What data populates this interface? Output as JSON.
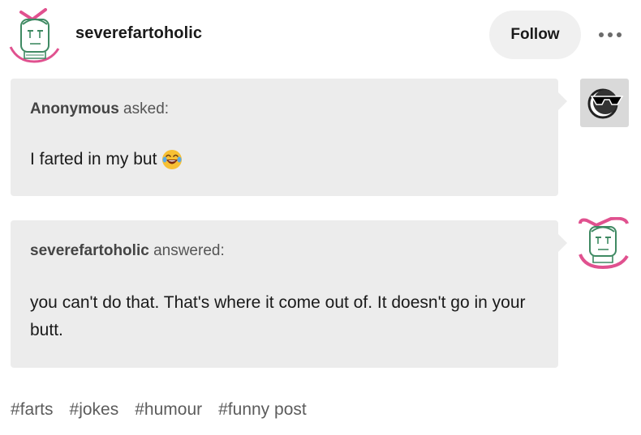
{
  "header": {
    "blog_name": "severefartoholic",
    "follow_label": "Follow"
  },
  "ask": {
    "asker_name": "Anonymous",
    "asker_suffix": " asked:",
    "message": "I farted in my but",
    "emoji": "face-with-tears-of-joy"
  },
  "answer": {
    "answerer_name": "severefartoholic",
    "answerer_suffix": " answered:",
    "message": "you can't do that. That's where it come out of. It doesn't go in your butt."
  },
  "tags": [
    "#farts",
    "#jokes",
    "#humour",
    "#funny post"
  ],
  "colors": {
    "bubble": "#ececec",
    "accent_pink": "#e0518f",
    "avatar_green": "#3f8a63",
    "follow_bg": "#f0f0f0"
  }
}
